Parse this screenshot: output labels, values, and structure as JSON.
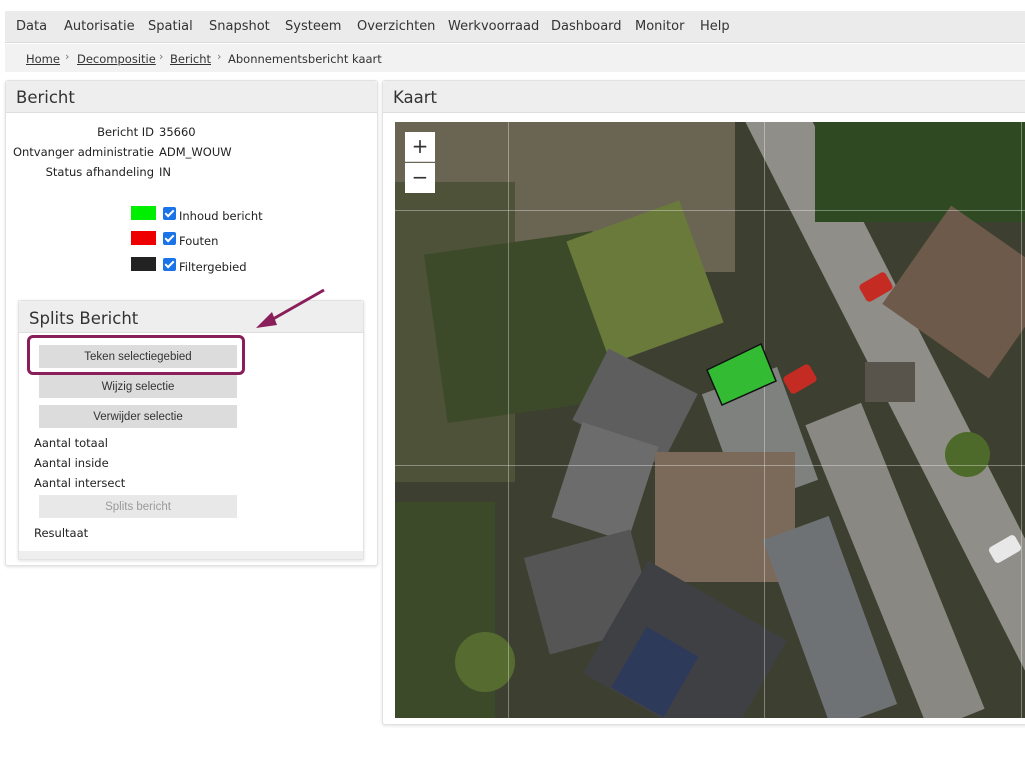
{
  "menu": [
    "Data",
    "Autorisatie",
    "Spatial",
    "Snapshot",
    "Systeem",
    "Overzichten",
    "Werkvoorraad",
    "Dashboard",
    "Monitor",
    "Help"
  ],
  "breadcrumb": {
    "items": [
      "Home",
      "Decompositie",
      "Bericht"
    ],
    "current": "Abonnementsbericht kaart",
    "separator": "›"
  },
  "bericht": {
    "title": "Bericht",
    "fields": [
      {
        "label": "Bericht ID",
        "value": "35660"
      },
      {
        "label": "Ontvanger administratie",
        "value": "ADM_WOUW"
      },
      {
        "label": "Status afhandeling",
        "value": "IN"
      }
    ],
    "legend": [
      {
        "label": "Inhoud bericht",
        "color": "#00ee00",
        "checked": true
      },
      {
        "label": "Fouten",
        "color": "#ee0000",
        "checked": true
      },
      {
        "label": "Filtergebied",
        "color": "#222222",
        "checked": true
      }
    ]
  },
  "splits": {
    "title": "Splits Bericht",
    "teken_label": "Teken selectiegebied",
    "wijzig_label": "Wijzig selectie",
    "verwijder_label": "Verwijder selectie",
    "aantal_totaal": "Aantal totaal",
    "aantal_inside": "Aantal inside",
    "aantal_intersect": "Aantal intersect",
    "splits_label": "Splits bericht",
    "resultaat": "Resultaat"
  },
  "kaart": {
    "title": "Kaart",
    "zoom_in": "+",
    "zoom_out": "−"
  },
  "colors": {
    "highlight": "#8a1e5a",
    "selection_polygon": "#33bb33"
  }
}
